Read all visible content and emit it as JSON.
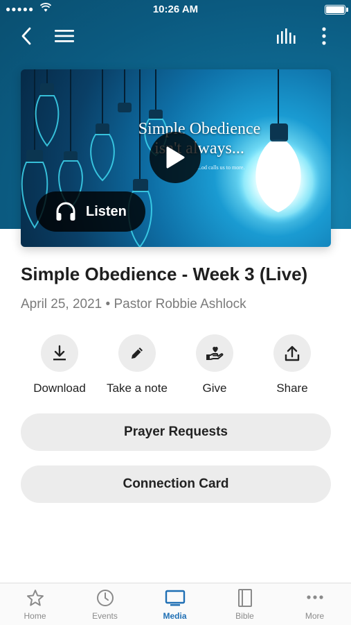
{
  "status_bar": {
    "signal": "●●●●●",
    "time": "10:26 AM"
  },
  "nav": {
    "back_icon": "chevron-left-icon",
    "menu_icon": "hamburger-icon",
    "audio_icon": "equalizer-icon",
    "more_icon": "vertical-dots-icon"
  },
  "hero": {
    "title_line1": "Simple Obedience",
    "title_line2": "isn't always...",
    "subtitle": "...od calls us to more.",
    "listen_label": "Listen"
  },
  "sermon": {
    "title": "Simple Obedience - Week 3 (Live)",
    "meta": "April 25, 2021 • Pastor Robbie Ashlock"
  },
  "actions": [
    {
      "label": "Download",
      "icon": "download-icon"
    },
    {
      "label": "Take a note",
      "icon": "pencil-icon"
    },
    {
      "label": "Give",
      "icon": "heart-hand-icon"
    },
    {
      "label": "Share",
      "icon": "share-icon"
    }
  ],
  "buttons": {
    "prayer": "Prayer Requests",
    "connection": "Connection Card"
  },
  "tabs": [
    {
      "label": "Home",
      "icon": "star-icon"
    },
    {
      "label": "Events",
      "icon": "clock-icon"
    },
    {
      "label": "Media",
      "icon": "tv-icon",
      "active": true
    },
    {
      "label": "Bible",
      "icon": "book-icon"
    },
    {
      "label": "More",
      "icon": "dots-icon"
    }
  ],
  "colors": {
    "header": "#0f6d96",
    "accent": "#1f6fb4",
    "pill_bg": "#ececec"
  }
}
